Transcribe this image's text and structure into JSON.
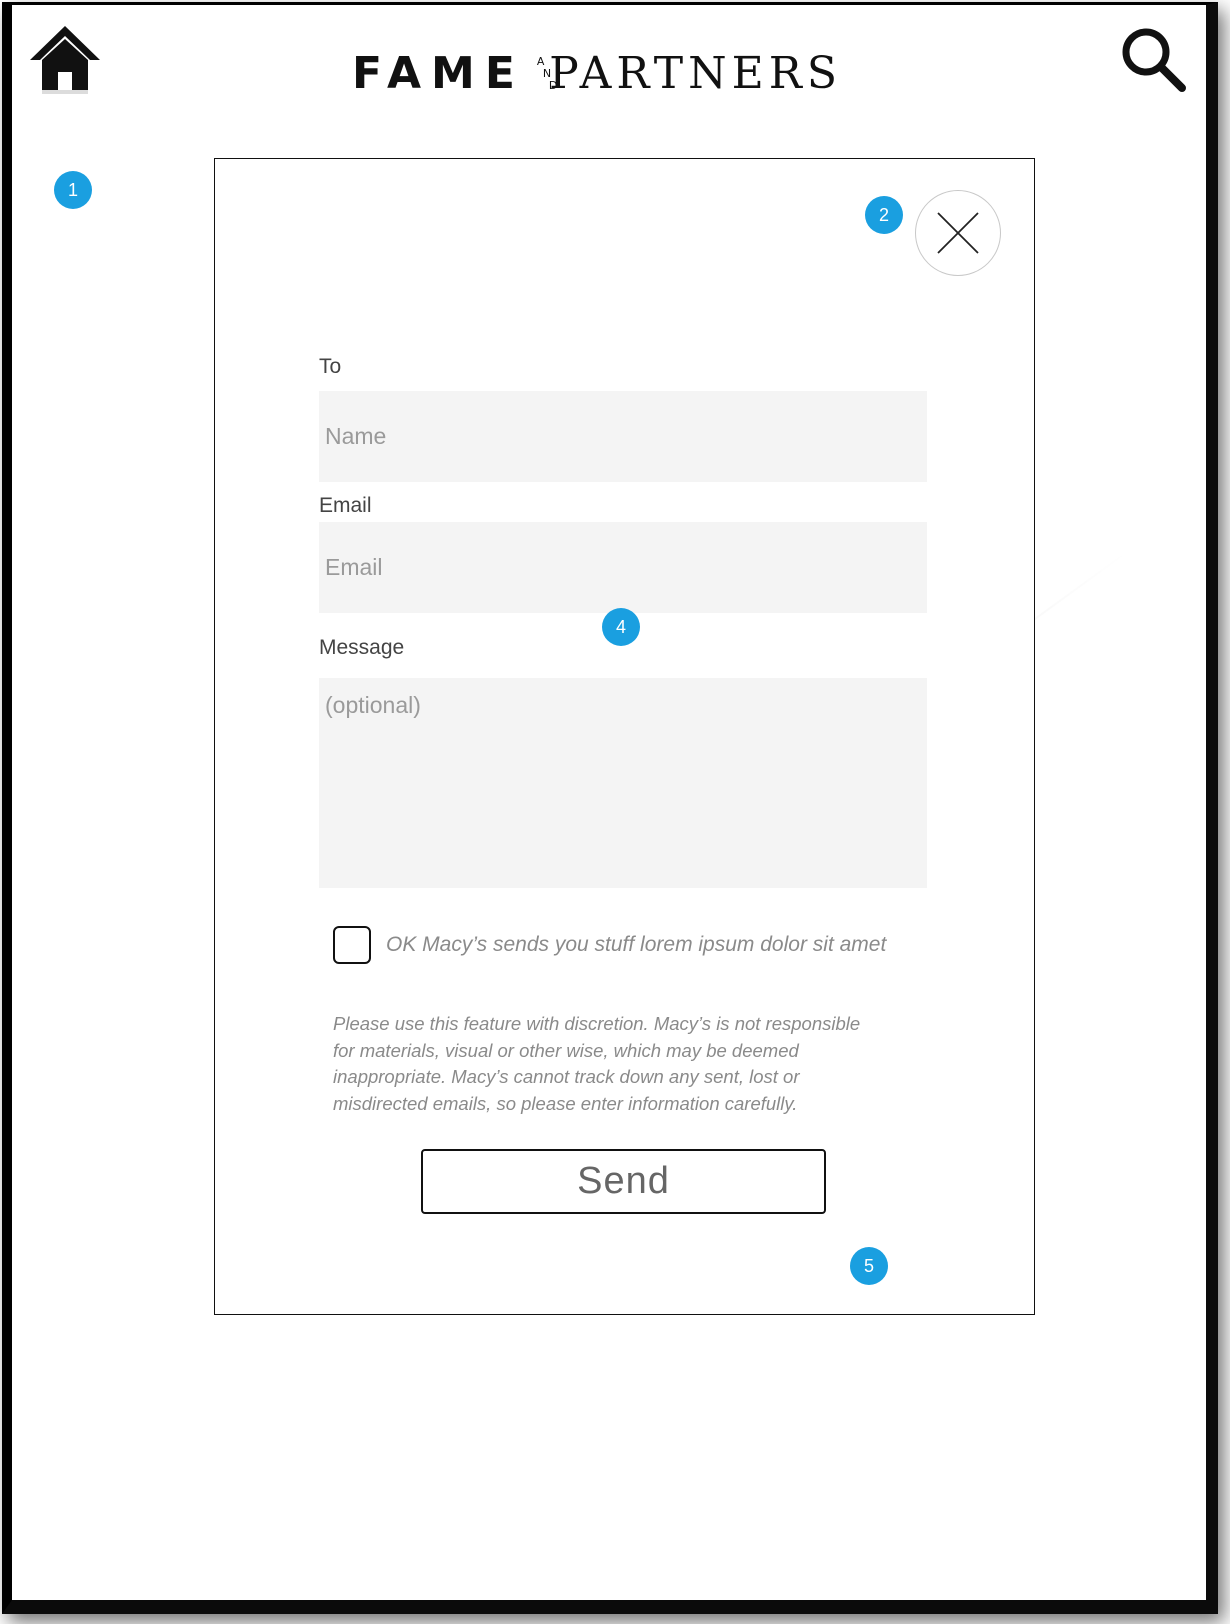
{
  "header": {
    "home_icon": "home-icon",
    "search_icon": "search-icon",
    "logo": {
      "word1": "FAME",
      "and_letters": [
        "A",
        "N",
        "D"
      ],
      "word2": "PARTNERS"
    }
  },
  "annotations": {
    "badge_1": "1",
    "badge_2": "2",
    "badge_4": "4",
    "badge_5": "5",
    "badge_color": "#1a9fe0"
  },
  "modal": {
    "close_icon": "close-icon",
    "to_label": "To",
    "name_placeholder": "Name",
    "email_label": "Email",
    "email_placeholder": "Email",
    "message_label": "Message",
    "message_placeholder": "(optional)",
    "optin_label": "OK Macy’s sends you stuff lorem ipsum dolor sit amet",
    "disclaimer_lines": [
      "Please use this feature with discretion. Macy’s is not responsible",
      "for  materials, visual or other wise, which may be deemed",
      "inappropriate. Macy’s cannot track down any sent, lost or",
      "misdirected emails, so please enter information carefully."
    ],
    "send_label": "Send"
  }
}
